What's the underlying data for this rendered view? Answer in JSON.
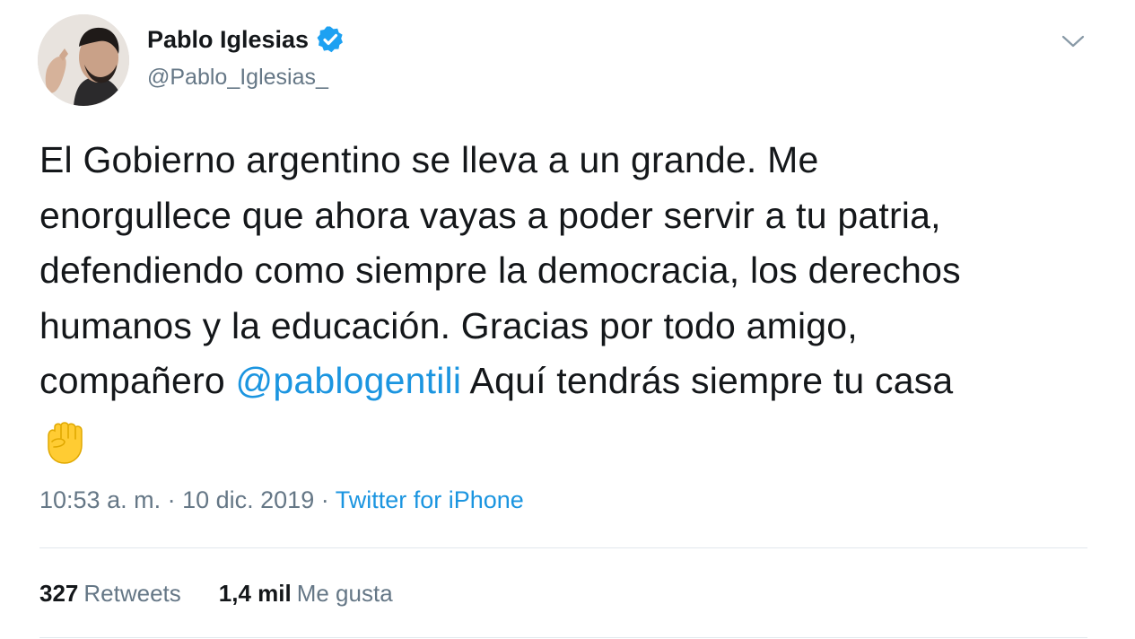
{
  "author": {
    "name": "Pablo Iglesias",
    "handle": "@Pablo_Iglesias_"
  },
  "tweet": {
    "lines": [
      "El Gobierno argentino se lleva a un grande. Me",
      "enorgullece que ahora vayas a poder servir a tu patria,",
      "defendiendo como siempre la democracia, los derechos",
      "humanos y la educación. Gracias por todo amigo,"
    ],
    "line5_before": "compañero ",
    "mention": "@pablogentili",
    "line5_after": " Aquí tendrás siempre tu casa",
    "emoji": "raised-fist-icon"
  },
  "meta": {
    "time": "10:53 a. m.",
    "separator1": " · ",
    "date": "10 dic. 2019",
    "separator2": " · ",
    "source": "Twitter for iPhone"
  },
  "stats": {
    "retweets_count": "327",
    "retweets_label": "Retweets",
    "likes_count": "1,4 mil",
    "likes_label": "Me gusta"
  },
  "colors": {
    "link": "#1b95e0",
    "secondary_text": "#657786",
    "primary_text": "#14171a",
    "verified_badge": "#1da1f2",
    "divider": "#e1e8ed"
  }
}
